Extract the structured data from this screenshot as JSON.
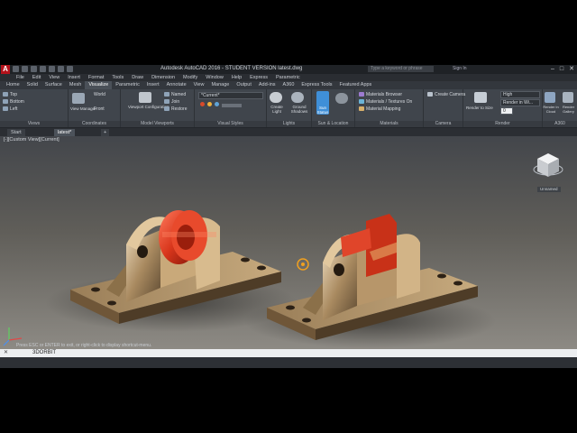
{
  "window": {
    "title": "Autodesk AutoCAD 2016 - STUDENT VERSION    latest.dwg",
    "search_placeholder": "Type a keyword or phrase",
    "user_label": "Sign In",
    "logo_letter": "A",
    "minimize": "–",
    "maximize": "□",
    "close": "✕"
  },
  "menu": [
    "File",
    "Edit",
    "View",
    "Insert",
    "Format",
    "Tools",
    "Draw",
    "Dimension",
    "Modify",
    "Window",
    "Help",
    "Express",
    "Parametric"
  ],
  "ribbon_tabs": [
    "Home",
    "Solid",
    "Surface",
    "Mesh",
    "Visualize",
    "Parametric",
    "Insert",
    "Annotate",
    "View",
    "Manage",
    "Output",
    "Add-ins",
    "A360",
    "Express Tools",
    "Featured Apps"
  ],
  "active_tab": "Visualize",
  "ribbon": {
    "views": {
      "label": "Views",
      "items": [
        "Top",
        "Bottom",
        "Left"
      ]
    },
    "coordinates": {
      "label": "Coordinates",
      "view_manager": "View Manager",
      "world": "World",
      "front": "Front"
    },
    "model_viewports": {
      "label": "Model Viewports",
      "viewport_config": "Viewport Configuration",
      "named": "Named",
      "join": "Join",
      "restore": "Restore"
    },
    "visual_styles": {
      "label": "Visual Styles",
      "current": "*Current*"
    },
    "lights": {
      "label": "Lights",
      "create_light": "Create Light",
      "ground_shadows": "Ground Shadows"
    },
    "sun_location": {
      "label": "Sun & Location",
      "sun_status": "Sun Status"
    },
    "materials": {
      "label": "Materials",
      "browser": "Materials Browser",
      "textures": "Materials / Textures On",
      "mapping": "Material Mapping"
    },
    "camera": {
      "label": "Camera",
      "create_camera": "Create Camera"
    },
    "render": {
      "label": "Render",
      "render_to_size": "Render to Size",
      "quality": "High",
      "render_in": "Render in Wi...",
      "value": "0"
    },
    "a360": {
      "label": "A360",
      "render_cloud": "Render in Cloud",
      "render_gallery": "Render Gallery"
    }
  },
  "doc_tabs": [
    "Start",
    "latest*"
  ],
  "viewport_label": "[-][Custom View][Current]",
  "viewcube_label": "Unnamed",
  "command_history": "Press ESC or ENTER to exit, or right-click to display shortcut-menu.",
  "command_line": "3DORBIT",
  "colors": {
    "accent": "#b3121b",
    "part_metal": "#8a7050",
    "part_red": "#d23a22"
  }
}
